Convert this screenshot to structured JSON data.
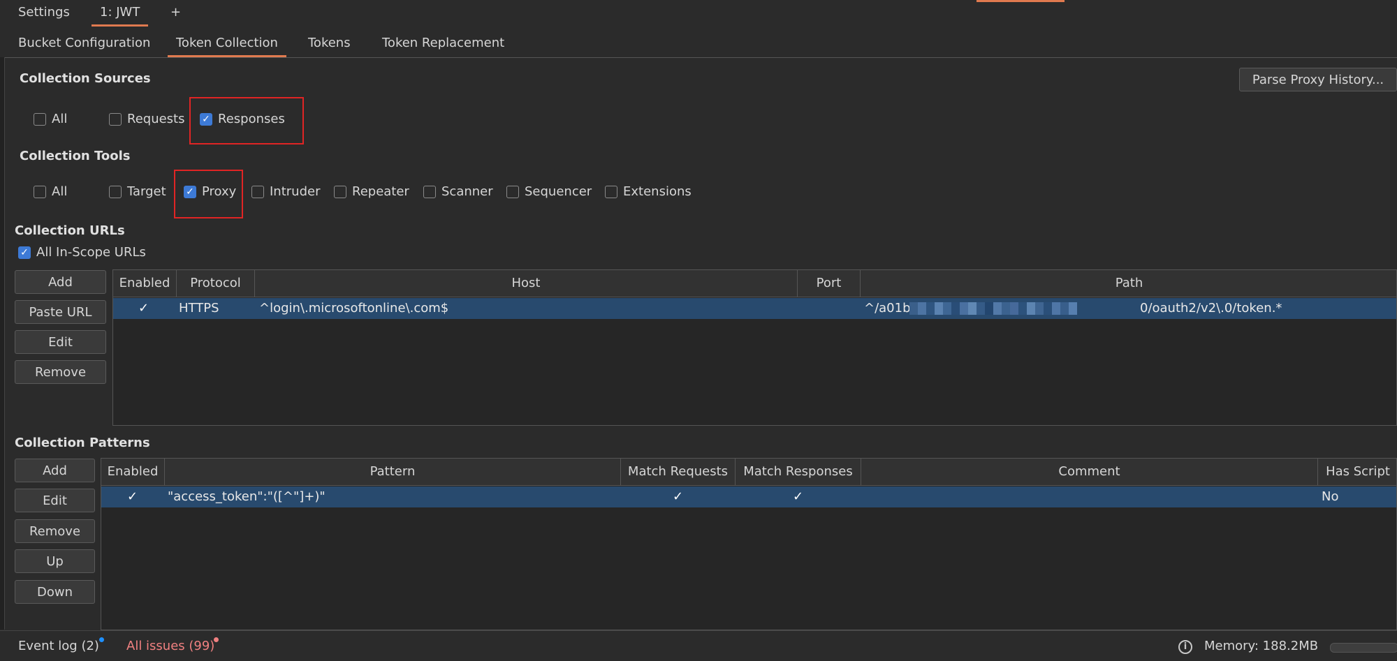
{
  "top_tabs": {
    "settings": "Settings",
    "jwt": "1: JWT",
    "add": "+"
  },
  "sub_tabs": {
    "bucket": "Bucket Configuration",
    "token_collection": "Token Collection",
    "tokens": "Tokens",
    "token_replacement": "Token Replacement"
  },
  "sources": {
    "title": "Collection Sources",
    "parse_button": "Parse Proxy History...",
    "all": "All",
    "requests": "Requests",
    "responses": "Responses"
  },
  "tools": {
    "title": "Collection Tools",
    "all": "All",
    "target": "Target",
    "proxy": "Proxy",
    "intruder": "Intruder",
    "repeater": "Repeater",
    "scanner": "Scanner",
    "sequencer": "Sequencer",
    "extensions": "Extensions"
  },
  "urls": {
    "title": "Collection URLs",
    "all_in_scope": "All In-Scope URLs",
    "buttons": {
      "add": "Add",
      "paste": "Paste URL",
      "edit": "Edit",
      "remove": "Remove"
    },
    "columns": {
      "enabled": "Enabled",
      "protocol": "Protocol",
      "host": "Host",
      "port": "Port",
      "path": "Path"
    },
    "rows": [
      {
        "enabled": "✓",
        "protocol": "HTTPS",
        "host": "^login\\.microsoftonline\\.com$",
        "port": "",
        "path_prefix": "^/a01b",
        "path_suffix": "0/oauth2/v2\\.0/token.*"
      }
    ]
  },
  "patterns": {
    "title": "Collection Patterns",
    "buttons": {
      "add": "Add",
      "edit": "Edit",
      "remove": "Remove",
      "up": "Up",
      "down": "Down"
    },
    "columns": {
      "enabled": "Enabled",
      "pattern": "Pattern",
      "match_requests": "Match Requests",
      "match_responses": "Match Responses",
      "comment": "Comment",
      "has_script": "Has Script"
    },
    "rows": [
      {
        "enabled": "✓",
        "pattern": "\"access_token\":\"([^\"]+)\"",
        "match_requests": "✓",
        "match_responses": "✓",
        "comment": "",
        "has_script": "No"
      }
    ]
  },
  "status": {
    "event_log": "Event log (2)",
    "all_issues": "All issues (99)",
    "memory": "Memory: 188.2MB"
  },
  "colors": {
    "accent": "#e07a4f",
    "selection": "#284a6e",
    "checkbox_on": "#3d7ad6",
    "highlight": "#e02424",
    "issues": "#f08080",
    "event_dot": "#1e90ff",
    "issues_dot": "#f08080"
  }
}
